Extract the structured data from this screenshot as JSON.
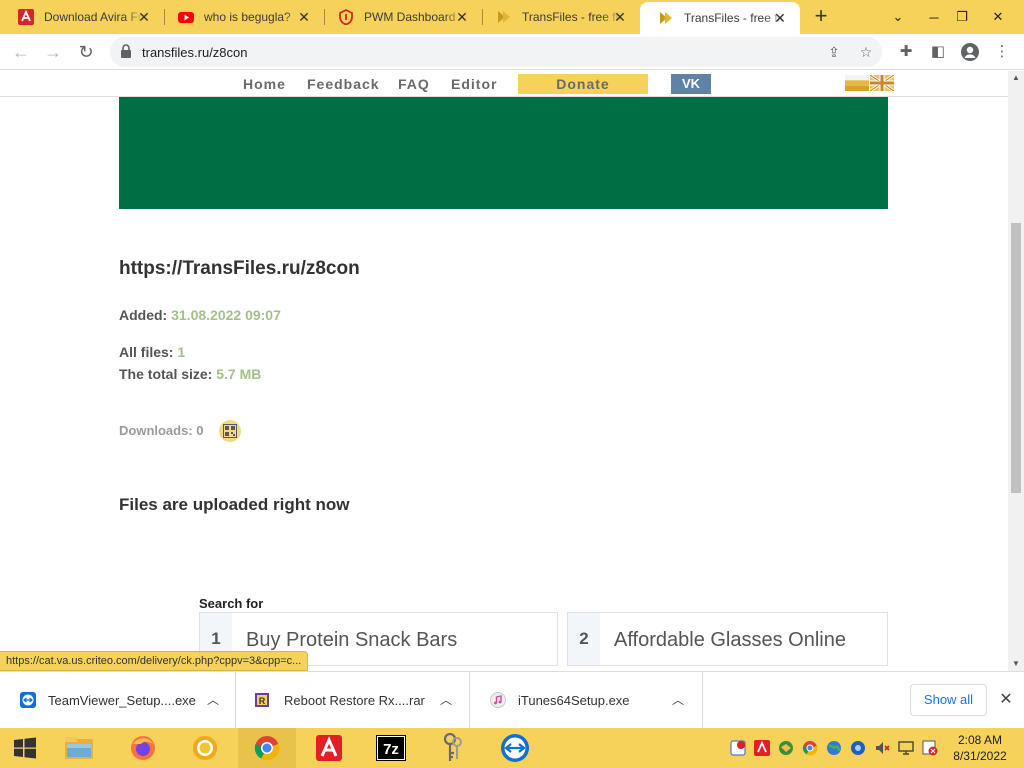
{
  "browser": {
    "tabs": [
      {
        "title": "Download Avira Free",
        "icon": "avira-icon"
      },
      {
        "title": "who is begugla?",
        "icon": "youtube-icon"
      },
      {
        "title": "PWM Dashboard",
        "icon": "pwm-shield-icon"
      },
      {
        "title": "TransFiles - free file",
        "icon": "transfiles-icon"
      },
      {
        "title": "TransFiles - free file",
        "icon": "transfiles-icon",
        "active": true
      }
    ],
    "address": "transfiles.ru/z8con"
  },
  "site": {
    "nav": {
      "home": "Home",
      "feedback": "Feedback",
      "faq": "FAQ",
      "editor": "Editor",
      "donate": "Donate",
      "vk": "VK"
    },
    "banner_color": "#006e45",
    "link_title": "https://TransFiles.ru/z8con",
    "added_label": "Added:",
    "added_value": "31.08.2022 09:07",
    "all_files_label": "All files:",
    "all_files_value": "1",
    "total_size_label": "The total size:",
    "total_size_value": "5.7 MB",
    "downloads_label": "Downloads:",
    "downloads_value": "0",
    "upload_status": "Files are uploaded right now",
    "search_for": "Search for",
    "ads": [
      {
        "num": "1",
        "text": "Buy Protein Snack Bars"
      },
      {
        "num": "2",
        "text": "Affordable Glasses Online"
      }
    ]
  },
  "status_url": "https://cat.va.us.criteo.com/delivery/ck.php?cppv=3&cpp=c...",
  "downloads": {
    "items": [
      {
        "name": "TeamViewer_Setup....exe",
        "icon": "teamviewer-icon"
      },
      {
        "name": "Reboot Restore Rx....rar",
        "icon": "rar-icon"
      },
      {
        "name": "iTunes64Setup.exe",
        "icon": "itunes-icon"
      }
    ],
    "show_all": "Show all"
  },
  "taskbar": {
    "time": "2:08 AM",
    "date": "8/31/2022",
    "apps": [
      "file-explorer-icon",
      "firefox-icon",
      "chrome-canary-icon",
      "chrome-icon",
      "avira-icon",
      "7zip-icon",
      "keys-icon",
      "teamviewer-icon"
    ]
  },
  "colors": {
    "theme_yellow": "#f6d25a",
    "value_green": "#a4c08a"
  }
}
